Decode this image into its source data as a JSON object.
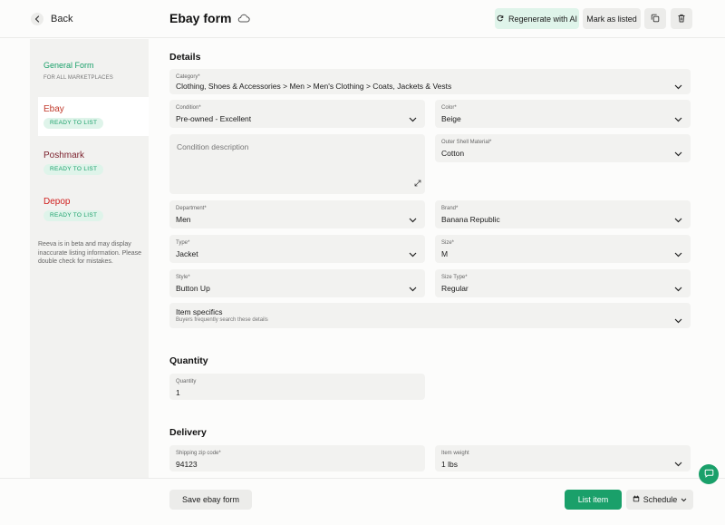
{
  "header": {
    "back_label": "Back",
    "title": "Ebay form",
    "regenerate_label": "Regenerate with AI",
    "mark_listed_label": "Mark as listed"
  },
  "sidebar": {
    "general": {
      "label": "General Form",
      "sub": "FOR ALL MARKETPLACES"
    },
    "items": [
      {
        "label": "Ebay",
        "badge": "READY TO LIST",
        "color": "#c0392b"
      },
      {
        "label": "Poshmark",
        "badge": "READY TO LIST",
        "color": "#7a1f2b"
      },
      {
        "label": "Depop",
        "badge": "READY TO LIST",
        "color": "#d0201f"
      }
    ],
    "note": "Reeva is in beta and may display inaccurate listing information. Please double check for mistakes."
  },
  "details": {
    "title": "Details",
    "category": {
      "label": "Category*",
      "value": "Clothing, Shoes & Accessories > Men > Men's Clothing > Coats, Jackets & Vests"
    },
    "condition": {
      "label": "Condition*",
      "value": "Pre-owned - Excellent"
    },
    "color": {
      "label": "Color*",
      "value": "Beige"
    },
    "condition_description": {
      "placeholder": "Condition description"
    },
    "outer_shell": {
      "label": "Outer Shell Material*",
      "value": "Cotton"
    },
    "department": {
      "label": "Department*",
      "value": "Men"
    },
    "brand": {
      "label": "Brand*",
      "value": "Banana Republic"
    },
    "type": {
      "label": "Type*",
      "value": "Jacket"
    },
    "size": {
      "label": "Size*",
      "value": "M"
    },
    "style": {
      "label": "Style*",
      "value": "Button Up"
    },
    "size_type": {
      "label": "Size Type*",
      "value": "Regular"
    },
    "item_specifics": {
      "label": "Item specifics",
      "sub": "Buyers frequently search these details"
    }
  },
  "quantity": {
    "title": "Quantity",
    "field": {
      "label": "Quantity",
      "value": "1"
    }
  },
  "delivery": {
    "title": "Delivery",
    "zip": {
      "label": "Shipping zip code*",
      "value": "94123"
    },
    "weight": {
      "label": "Item weight",
      "value": "1 lbs"
    }
  },
  "footer": {
    "save_label": "Save ebay form",
    "list_label": "List item",
    "schedule_label": "Schedule"
  },
  "colors": {
    "accent": "#1aa06a",
    "accent_light": "#dff4ea",
    "field_bg": "#f2f2f0"
  }
}
